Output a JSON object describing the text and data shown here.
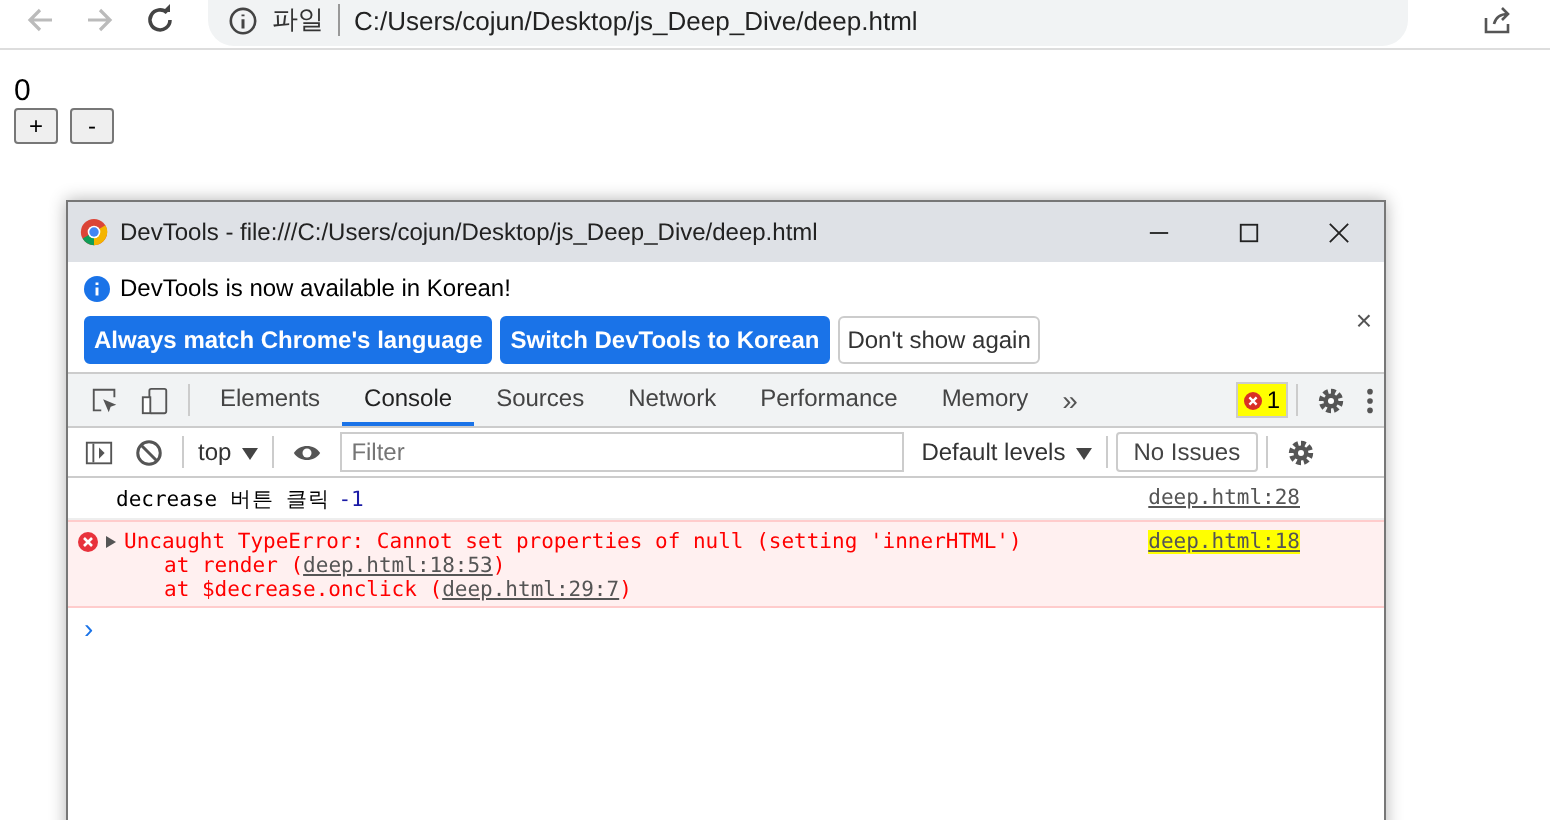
{
  "browser": {
    "site_label": "파일",
    "url": "C:/Users/cojun/Desktop/js_Deep_Dive/deep.html"
  },
  "page": {
    "counter": "0",
    "buttons": [
      "+",
      "-"
    ]
  },
  "devtools": {
    "title": "DevTools - file:///C:/Users/cojun/Desktop/js_Deep_Dive/deep.html",
    "infobar": {
      "message": "DevTools is now available in Korean!",
      "buttons": [
        {
          "label": "Always match Chrome's language",
          "kind": "primary"
        },
        {
          "label": "Switch DevTools to Korean",
          "kind": "primary"
        },
        {
          "label": "Don't show again",
          "kind": "plain"
        }
      ],
      "close": "×"
    },
    "tabs": [
      {
        "label": "Elements",
        "selected": false
      },
      {
        "label": "Console",
        "selected": true
      },
      {
        "label": "Sources",
        "selected": false
      },
      {
        "label": "Network",
        "selected": false
      },
      {
        "label": "Performance",
        "selected": false
      },
      {
        "label": "Memory",
        "selected": false
      }
    ],
    "more_tabs": "»",
    "error_badge": {
      "count": "1",
      "highlighted": true
    },
    "console_toolbar": {
      "context": "top",
      "filter": {
        "placeholder": "Filter"
      },
      "levels": "Default levels",
      "issues": "No Issues"
    },
    "messages": [
      {
        "kind": "log",
        "text": "decrease 버튼 클릭",
        "value": "-1",
        "source": {
          "label": "deep.html:28",
          "highlighted": false
        }
      },
      {
        "kind": "error",
        "text": "Uncaught TypeError: Cannot set properties of null (setting 'innerHTML')",
        "source": {
          "label": "deep.html:18",
          "highlighted": true
        },
        "stack": [
          {
            "prefix": "at render (",
            "link": "deep.html:18:53",
            "suffix": ")"
          },
          {
            "prefix": "at $decrease.onclick (",
            "link": "deep.html:29:7",
            "suffix": ")"
          }
        ]
      }
    ],
    "prompt": "›"
  }
}
